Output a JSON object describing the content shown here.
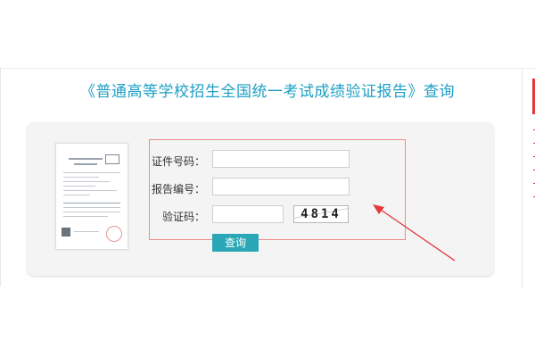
{
  "title": "《普通高等学校招生全国统一考试成绩验证报告》查询",
  "form": {
    "cert_no_label": "证件号码：",
    "cert_no_value": "",
    "report_no_label": "报告编号：",
    "report_no_value": "",
    "captcha_label": "验证码：",
    "captcha_value": "",
    "captcha_code": "4814",
    "submit_label": "查询"
  },
  "icons": {
    "certificate": "certificate-thumbnail-icon",
    "arrow": "annotation-arrow-icon"
  },
  "colors": {
    "title": "#1e9fc4",
    "button": "#2aa7b6",
    "highlight": "#f08a8a",
    "arrow": "#e4393c"
  }
}
